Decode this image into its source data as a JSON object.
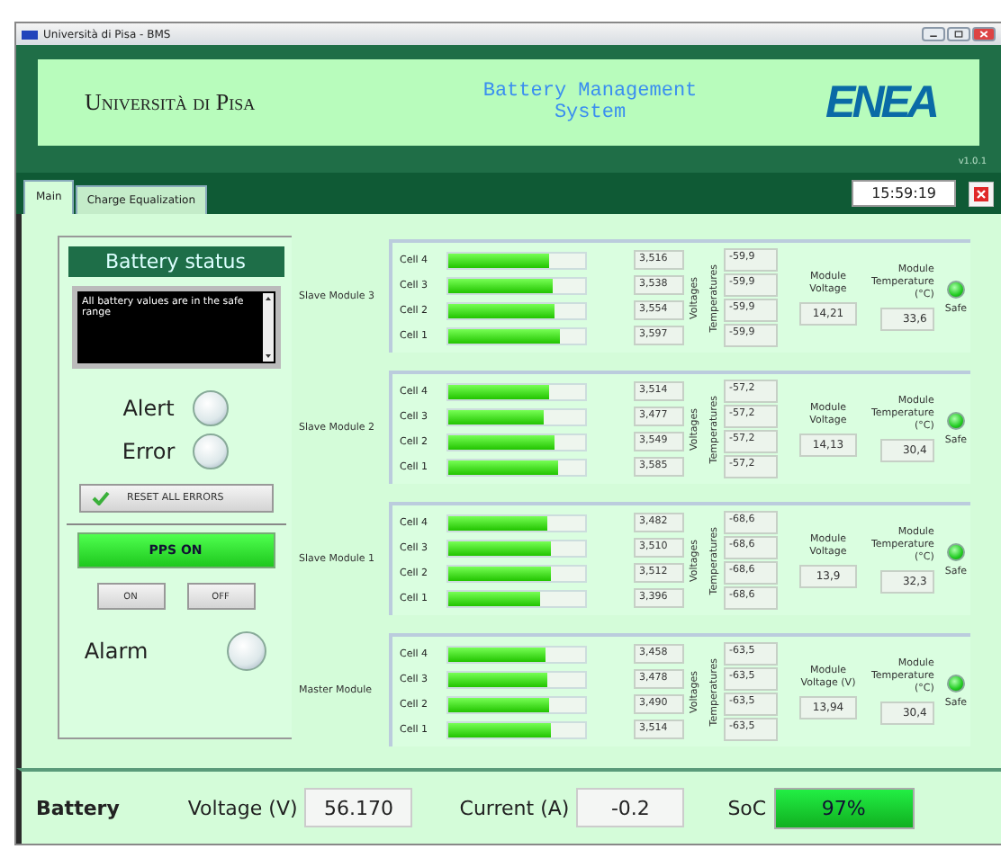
{
  "window": {
    "title": "Università di Pisa - BMS"
  },
  "header": {
    "university": "Università di Pisa",
    "app_title": "Battery Management System",
    "logo": "ENEA",
    "version": "v1.0.1"
  },
  "tabs": [
    {
      "label": "Main",
      "selected": true
    },
    {
      "label": "Charge Equalization",
      "selected": false
    }
  ],
  "clock": "15:59:19",
  "status": {
    "title": "Battery status",
    "message": "All battery values are in the safe range",
    "indicators": [
      {
        "label": "Alert",
        "on": false
      },
      {
        "label": "Error",
        "on": false
      }
    ],
    "reset_button": "RESET ALL ERRORS"
  },
  "pps": {
    "label": "PPS ON",
    "on": true,
    "buttons": [
      "ON",
      "OFF"
    ],
    "alarm": {
      "label": "Alarm",
      "on": false
    }
  },
  "modules": [
    {
      "name": "Slave Module 3",
      "voltages_label": "Voltages",
      "temperatures_label": "Temperatures",
      "voltage_label": "Module Voltage",
      "voltage": "14,21",
      "temperature_label": "Module Temperature (°C)",
      "temperature": "33,6",
      "state_label": "Safe",
      "safe": true,
      "cells": [
        {
          "label": "Cell 4",
          "level": 0.74,
          "voltage": "3,516",
          "temperature": "-59,9"
        },
        {
          "label": "Cell 3",
          "level": 0.76,
          "voltage": "3,538",
          "temperature": "-59,9"
        },
        {
          "label": "Cell 2",
          "level": 0.77,
          "voltage": "3,554",
          "temperature": "-59,9"
        },
        {
          "label": "Cell 1",
          "level": 0.81,
          "voltage": "3,597",
          "temperature": "-59,9"
        }
      ]
    },
    {
      "name": "Slave Module 2",
      "voltages_label": "Voltages",
      "temperatures_label": "Temperatures",
      "voltage_label": "Module Voltage",
      "voltage": "14,13",
      "temperature_label": "Module Temperature (°C)",
      "temperature": "30,4",
      "state_label": "Safe",
      "safe": true,
      "cells": [
        {
          "label": "Cell 4",
          "level": 0.74,
          "voltage": "3,514",
          "temperature": "-57,2"
        },
        {
          "label": "Cell 3",
          "level": 0.7,
          "voltage": "3,477",
          "temperature": "-57,2"
        },
        {
          "label": "Cell 2",
          "level": 0.77,
          "voltage": "3,549",
          "temperature": "-57,2"
        },
        {
          "label": "Cell 1",
          "level": 0.8,
          "voltage": "3,585",
          "temperature": "-57,2"
        }
      ]
    },
    {
      "name": "Slave Module 1",
      "voltages_label": "Voltages",
      "temperatures_label": "Temperatures",
      "voltage_label": "Module Voltage",
      "voltage": "13,9",
      "temperature_label": "Module Temperature (°C)",
      "temperature": "32,3",
      "state_label": "Safe",
      "safe": true,
      "cells": [
        {
          "label": "Cell 4",
          "level": 0.73,
          "voltage": "3,482",
          "temperature": "-68,6"
        },
        {
          "label": "Cell 3",
          "level": 0.75,
          "voltage": "3,510",
          "temperature": "-68,6"
        },
        {
          "label": "Cell 2",
          "level": 0.75,
          "voltage": "3,512",
          "temperature": "-68,6"
        },
        {
          "label": "Cell 1",
          "level": 0.67,
          "voltage": "3,396",
          "temperature": "-68,6"
        }
      ]
    },
    {
      "name": "Master Module",
      "voltages_label": "Voltages",
      "temperatures_label": "Temperatures",
      "voltage_label": "Module Voltage (V)",
      "voltage": "13,94",
      "temperature_label": "Module Temperature (°C)",
      "temperature": "30,4",
      "state_label": "Safe",
      "safe": true,
      "cells": [
        {
          "label": "Cell 4",
          "level": 0.71,
          "voltage": "3,458",
          "temperature": "-63,5"
        },
        {
          "label": "Cell 3",
          "level": 0.73,
          "voltage": "3,478",
          "temperature": "-63,5"
        },
        {
          "label": "Cell 2",
          "level": 0.74,
          "voltage": "3,490",
          "temperature": "-63,5"
        },
        {
          "label": "Cell 1",
          "level": 0.75,
          "voltage": "3,514",
          "temperature": "-63,5"
        }
      ]
    }
  ],
  "battery": {
    "label": "Battery",
    "voltage_label": "Voltage (V)",
    "voltage": "56.170",
    "current_label": "Current (A)",
    "current": "-0.2",
    "soc_label": "SoC",
    "soc": "97%"
  }
}
